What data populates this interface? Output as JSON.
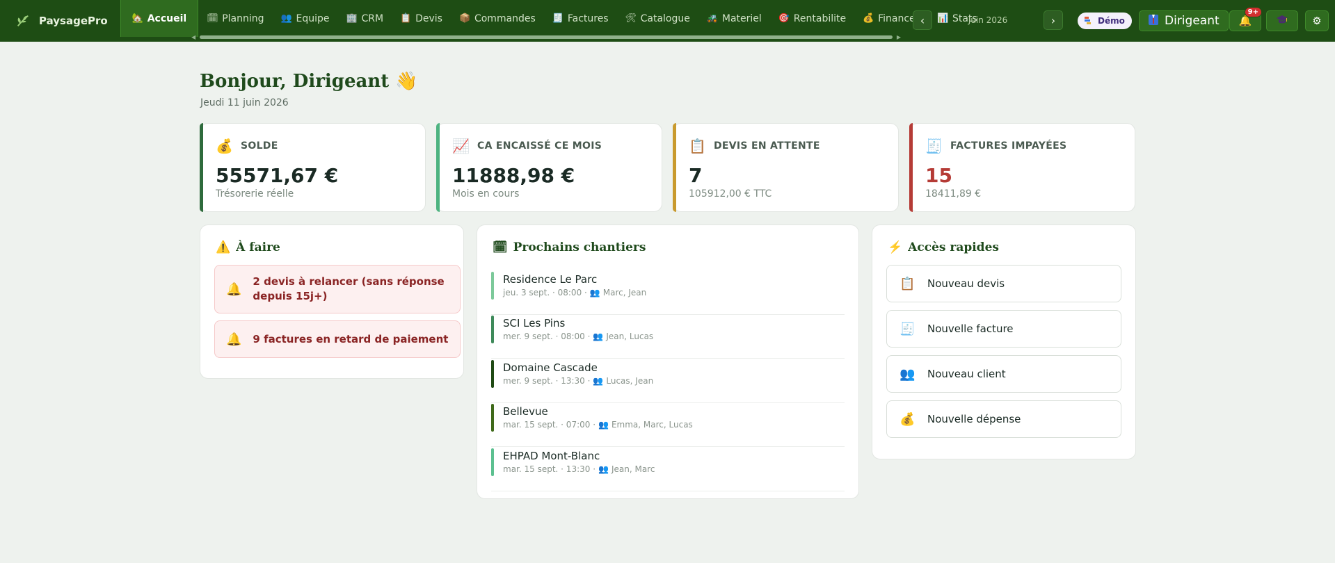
{
  "app": {
    "name": "PaysagePro"
  },
  "nav": {
    "items": [
      {
        "label": "Accueil",
        "icon": "🏡"
      },
      {
        "label": "Planning",
        "icon": "🗓"
      },
      {
        "label": "Equipe",
        "icon": "👥"
      },
      {
        "label": "CRM",
        "icon": "🏢"
      },
      {
        "label": "Devis",
        "icon": "📋"
      },
      {
        "label": "Commandes",
        "icon": "📦"
      },
      {
        "label": "Factures",
        "icon": "🧾"
      },
      {
        "label": "Catalogue",
        "icon": "🛠"
      },
      {
        "label": "Materiel",
        "icon": "🚜"
      },
      {
        "label": "Rentabilite",
        "icon": "🎯"
      },
      {
        "label": "Finances",
        "icon": "💰"
      },
      {
        "label": "Stats",
        "icon": "📊"
      }
    ]
  },
  "month_nav": {
    "prev": "‹",
    "label": "Juin 2026",
    "next": "›"
  },
  "demo": {
    "label": "Démo"
  },
  "role": {
    "label": "Dirigeant"
  },
  "notifications": {
    "count": "9+"
  },
  "greeting": {
    "title": "Bonjour, Dirigeant 👋",
    "date": "Jeudi 11 juin 2026"
  },
  "kpis": [
    {
      "label": "SOLDE",
      "icon": "💰",
      "value": "55571,67 €",
      "sub": "Trésorerie réelle"
    },
    {
      "label": "CA ENCAISSÉ CE MOIS",
      "icon": "📈",
      "value": "11888,98 €",
      "sub": "Mois en cours"
    },
    {
      "label": "DEVIS EN ATTENTE",
      "icon": "📋",
      "value": "7",
      "sub": "105912,00 € TTC"
    },
    {
      "label": "FACTURES IMPAYÉES",
      "icon": "🧾",
      "value": "15",
      "sub": "18411,89 €"
    }
  ],
  "todo": {
    "title": "À faire",
    "icon": "⚠️",
    "items": [
      {
        "text": "2 devis à relancer (sans réponse depuis 15j+)",
        "icon": "🔔"
      },
      {
        "text": "9 factures en retard de paiement",
        "icon": "🔔"
      }
    ]
  },
  "chantiers": {
    "title": "Prochains chantiers",
    "icon": "🗓",
    "items": [
      {
        "name": "Residence Le Parc",
        "meta": "jeu. 3 sept. · 08:00 ·",
        "team": "Marc, Jean",
        "color": "#7cc99a"
      },
      {
        "name": "SCI Les Pins",
        "meta": "mer. 9 sept. · 08:00 ·",
        "team": "Jean, Lucas",
        "color": "#3e8a5a"
      },
      {
        "name": "Domaine Cascade",
        "meta": "mer. 9 sept. · 13:30 ·",
        "team": "Lucas, Jean",
        "color": "#1f4a14"
      },
      {
        "name": "Bellevue",
        "meta": "mar. 15 sept. · 07:00 ·",
        "team": "Emma, Marc, Lucas",
        "color": "#3f6a1a"
      },
      {
        "name": "EHPAD Mont-Blanc",
        "meta": "mar. 15 sept. · 13:30 ·",
        "team": "Jean, Marc",
        "color": "#5cc090"
      }
    ]
  },
  "quick": {
    "title": "Accès rapides",
    "icon": "⚡",
    "items": [
      {
        "label": "Nouveau devis",
        "icon": "📋"
      },
      {
        "label": "Nouvelle facture",
        "icon": "🧾"
      },
      {
        "label": "Nouveau client",
        "icon": "👥"
      },
      {
        "label": "Nouvelle dépense",
        "icon": "💰"
      }
    ]
  }
}
